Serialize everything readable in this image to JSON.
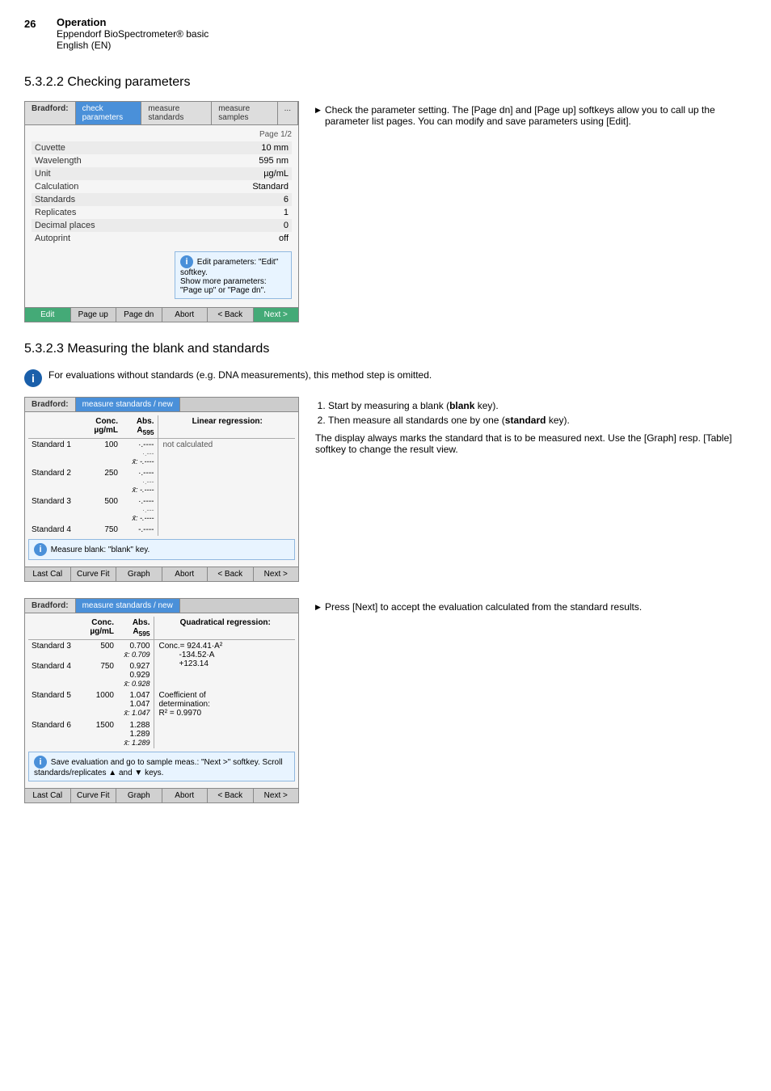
{
  "header": {
    "page_number": "26",
    "category": "Operation",
    "product": "Eppendorf BioSpectrometer® basic",
    "language": "English (EN)"
  },
  "section_5322": {
    "title": "5.3.2.2   Checking parameters",
    "device_tabs": [
      {
        "label": "Bradford:",
        "active": false
      },
      {
        "label": "check parameters",
        "active": true
      },
      {
        "label": "measure standards",
        "active": false
      },
      {
        "label": "measure samples",
        "active": false
      },
      {
        "label": "...",
        "active": false
      }
    ],
    "params": [
      {
        "label": "Cuvette",
        "value": "10 mm"
      },
      {
        "label": "Wavelength",
        "value": "595 nm"
      },
      {
        "label": "Unit",
        "value": "µg/mL"
      },
      {
        "label": "Calculation",
        "value": "Standard"
      },
      {
        "label": "Standards",
        "value": "6"
      },
      {
        "label": "Replicates",
        "value": "1"
      },
      {
        "label": "Decimal places",
        "value": "0"
      },
      {
        "label": "Autoprint",
        "value": "off"
      }
    ],
    "page_label": "Page 1/2",
    "info_text1": "Edit parameters: \"Edit\" softkey.",
    "info_text2": "Show more parameters: \"Page up\" or \"Page dn\".",
    "footer_buttons": [
      "Edit",
      "Page up",
      "Page dn",
      "Abort",
      "< Back",
      "Next >"
    ],
    "description_bullets": [
      "Check the parameter setting. The [Page dn] and [Page up] softkeys allow you to call up the parameter list pages. You can modify and save parameters using [Edit]."
    ]
  },
  "section_5323": {
    "title": "5.3.2.3   Measuring the blank and standards",
    "info_note": "For evaluations without standards (e.g. DNA measurements), this method step is omitted.",
    "device1": {
      "tab_label": "Bradford:",
      "tab_active": "measure standards / new",
      "col_headers": [
        "",
        "Conc.\nµg/mL",
        "Abs.\nA₅₉₅",
        "Linear regression:"
      ],
      "regression_value": "not calculated",
      "standards": [
        {
          "name": "Standard 1",
          "conc": "100",
          "reps": [
            "·.----",
            "·.---"
          ],
          "mean": "x̄: -.----"
        },
        {
          "name": "Standard 2",
          "conc": "250",
          "reps": [
            "·.----",
            "·.---"
          ],
          "mean": "x̄: -.----"
        },
        {
          "name": "Standard 3",
          "conc": "500",
          "reps": [
            "·.----",
            "·.---"
          ],
          "mean": "x̄: -.----"
        },
        {
          "name": "Standard 4",
          "conc": "750",
          "reps": [
            "-.----"
          ],
          "mean": ""
        }
      ],
      "info_text": "Measure blank: \"blank\" key.",
      "footer_buttons": [
        "Last Cal",
        "Curve Fit",
        "Graph",
        "Abort",
        "< Back",
        "Next >"
      ]
    },
    "description_numbered": [
      "Start by measuring a blank (blank key).",
      "Then measure all standards one by one (standard key)."
    ],
    "description_text": "The display always marks the standard that is to be measured next. Use the [Graph] resp. [Table] softkey to change the result view.",
    "device2": {
      "tab_label": "Bradford:",
      "tab_active": "measure standards / new",
      "col_headers": [
        "",
        "Conc.\nµg/mL",
        "Abs.\nA₅₉₅",
        "Quadratical regression:"
      ],
      "regression_formula": "Conc.= 924.41·A²\n-134.52·A\n+123.14",
      "standards": [
        {
          "name": "Standard 3",
          "conc": "500",
          "reps": [
            "0.700"
          ],
          "mean": "x̄: 0.709"
        },
        {
          "name": "Standard 4",
          "conc": "750",
          "reps": [
            "0.927",
            "0.929"
          ],
          "mean": "x̄: 0.928"
        },
        {
          "name": "Standard 5",
          "conc": "1000",
          "reps": [
            "1.047",
            "1.047"
          ],
          "mean": "x̄: 1.047"
        },
        {
          "name": "Standard 6",
          "conc": "1500",
          "reps": [
            "1.288",
            "1.289"
          ],
          "mean": "x̄: 1.289"
        }
      ],
      "coeff_label": "Coefficient of determination:",
      "coeff_value": "R² = 0.9970",
      "info_text": "Save evaluation and go to sample meas.: \"Next >\" softkey. Scroll standards/replicates ▲ and ▼ keys.",
      "footer_buttons": [
        "Last Cal",
        "Curve Fit",
        "Graph",
        "Abort",
        "< Back",
        "Next >"
      ]
    },
    "description_bullet2": "Press [Next] to accept the evaluation calculated from the standard results."
  }
}
